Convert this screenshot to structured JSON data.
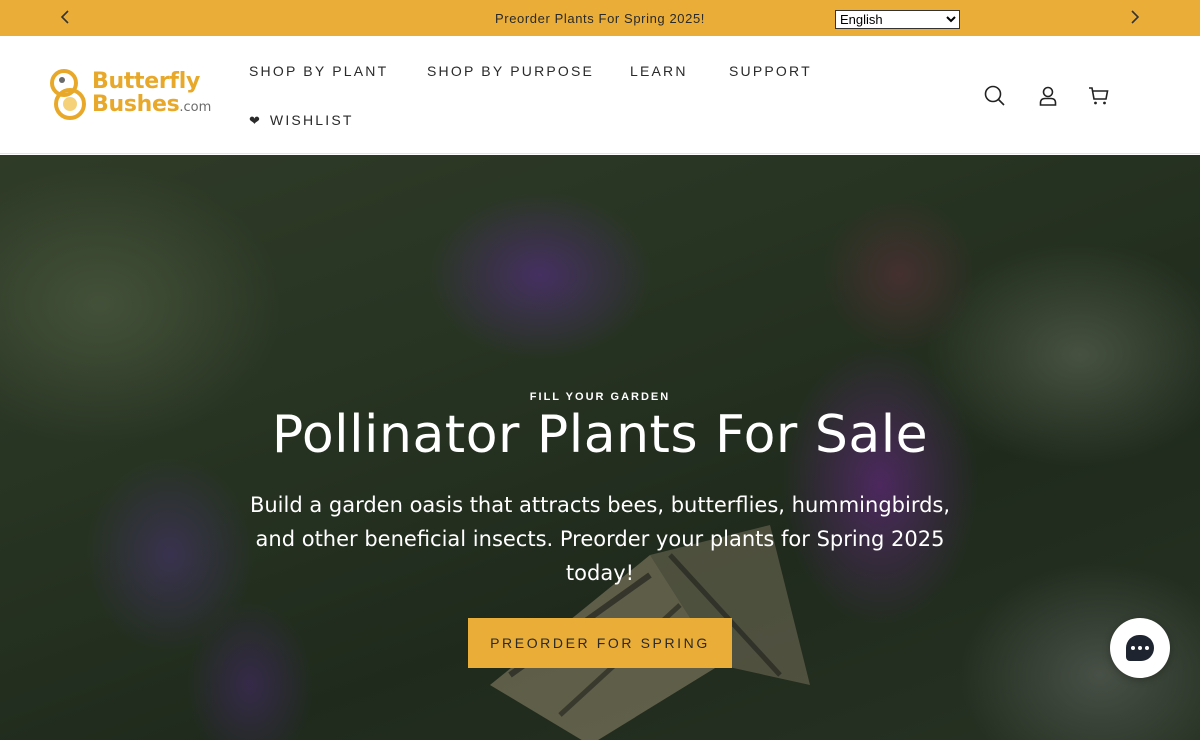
{
  "announcement": {
    "message": "Preorder Plants For Spring 2025!",
    "language_selected": "English",
    "icons": {
      "prev": "chevron-left-icon",
      "next": "chevron-right-icon"
    }
  },
  "header": {
    "logo": {
      "line1": "Butterfly",
      "line2": "Bushes",
      "suffix": ".com"
    },
    "nav": [
      {
        "label": "SHOP BY PLANT"
      },
      {
        "label": "SHOP BY PURPOSE"
      },
      {
        "label": "LEARN"
      },
      {
        "label": "SUPPORT"
      },
      {
        "label": "WISHLIST",
        "icon": "heart-icon"
      }
    ],
    "icons": [
      "search-icon",
      "account-icon",
      "cart-icon"
    ]
  },
  "hero": {
    "eyebrow": "FILL YOUR GARDEN",
    "title": "Pollinator Plants For Sale",
    "subtitle": "Build a garden oasis that attracts bees, butterflies, hummingbirds, and other beneficial insects. Preorder your plants for Spring 2025 today!",
    "cta_label": "PREORDER FOR SPRING"
  },
  "chat": {
    "icon": "chat-icon"
  },
  "colors": {
    "accent": "#eaae38",
    "header_bg": "#ffffff",
    "text_dark": "#2a2a2a"
  }
}
